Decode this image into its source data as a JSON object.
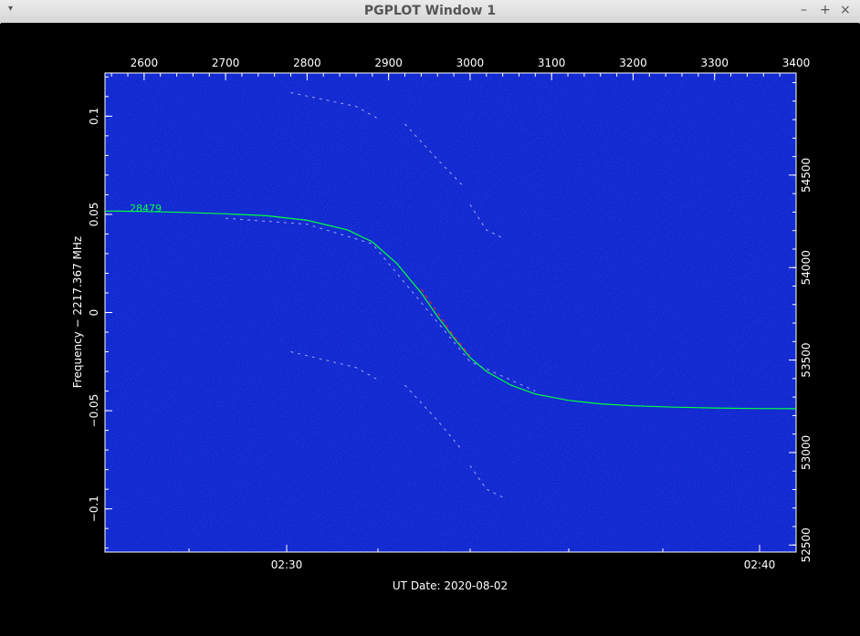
{
  "window": {
    "title": "PGPLOT Window 1",
    "menu_icon": "▾",
    "min_icon": "–",
    "max_icon": "+",
    "close_icon": "×"
  },
  "chart_data": {
    "type": "heatmap",
    "overlay": "line",
    "xlabel": "UT Date: 2020-08-02",
    "ylabel": "Frequency − 2217.367 MHz",
    "top_axis_ticks": [
      "2600",
      "2700",
      "2800",
      "2900",
      "3000",
      "3100",
      "3200",
      "3300",
      "3400"
    ],
    "top_axis_range": [
      2552,
      3400
    ],
    "left_axis_ticks": [
      "0.1",
      "0.05",
      "0",
      "−0.05",
      "−0.1"
    ],
    "left_axis_values": [
      0.1,
      0.05,
      0,
      -0.05,
      -0.1
    ],
    "left_axis_range": [
      -0.122,
      0.122
    ],
    "right_axis_ticks": [
      "54500",
      "54000",
      "53500",
      "53000",
      "52500"
    ],
    "right_axis_values": [
      54500,
      54000,
      53500,
      53000,
      52500
    ],
    "right_axis_range": [
      52462,
      55052
    ],
    "bottom_axis_ticks": [
      "02:30",
      "02:40"
    ],
    "curve_label": "28479",
    "curve_color": "#00ff40",
    "background_color": "#0a1ec8",
    "curve": {
      "x": [
        2552,
        2600,
        2650,
        2700,
        2750,
        2800,
        2850,
        2880,
        2910,
        2940,
        2960,
        2980,
        3000,
        3020,
        3050,
        3080,
        3120,
        3160,
        3200,
        3250,
        3300,
        3350,
        3400
      ],
      "y": [
        0.0517,
        0.0515,
        0.051,
        0.0503,
        0.0493,
        0.047,
        0.042,
        0.036,
        0.025,
        0.01,
        -0.002,
        -0.013,
        -0.023,
        -0.03,
        -0.037,
        -0.0415,
        -0.0447,
        -0.0465,
        -0.0475,
        -0.0482,
        -0.0486,
        -0.0489,
        -0.049
      ]
    }
  }
}
